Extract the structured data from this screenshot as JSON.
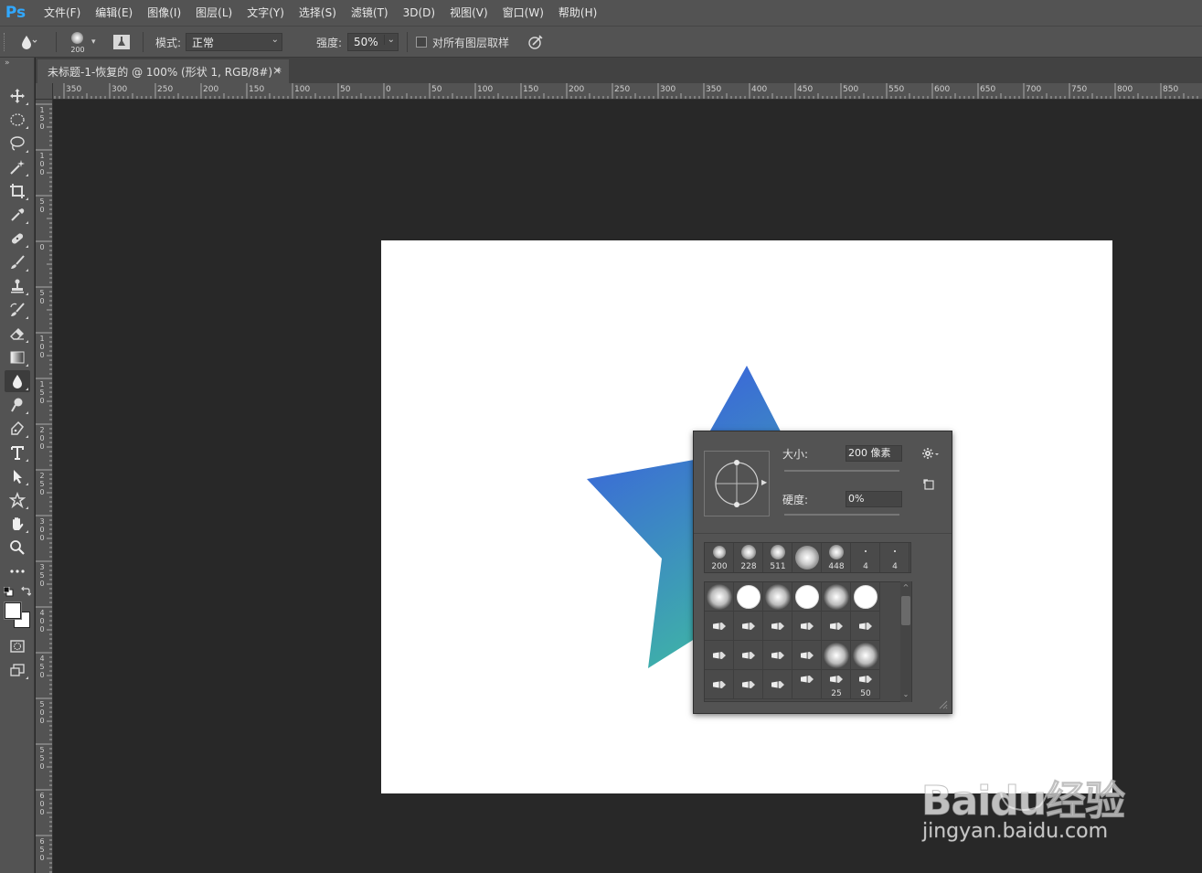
{
  "app": {
    "logo": "Ps"
  },
  "menu": [
    "文件(F)",
    "编辑(E)",
    "图像(I)",
    "图层(L)",
    "文字(Y)",
    "选择(S)",
    "滤镜(T)",
    "3D(D)",
    "视图(V)",
    "窗口(W)",
    "帮助(H)"
  ],
  "options": {
    "brush_size": "200",
    "mode_label": "模式:",
    "mode_value": "正常",
    "strength_label": "强度:",
    "strength_value": "50%",
    "sample_all_label": "对所有图层取样"
  },
  "document": {
    "tab_title": "未标题-1-恢复的 @ 100% (形状 1, RGB/8#) *",
    "close_glyph": "×"
  },
  "ruler_top": [
    "350",
    "300",
    "250",
    "200",
    "150",
    "100",
    "50",
    "0",
    "50",
    "100",
    "150",
    "200",
    "250",
    "300",
    "350",
    "400",
    "450",
    "500",
    "550",
    "600",
    "650",
    "700",
    "750",
    "800",
    "850"
  ],
  "ruler_left": [
    "150",
    "100",
    "50",
    "0",
    "50",
    "100",
    "150",
    "200",
    "250",
    "300",
    "350",
    "400",
    "450",
    "500",
    "550",
    "600",
    "650"
  ],
  "star": {
    "gradient_start": "#3a5de0",
    "gradient_end": "#3fbf9f"
  },
  "brush_picker": {
    "size_label": "大小:",
    "size_value": "200 像素",
    "hardness_label": "硬度:",
    "hardness_value": "0%",
    "size_slider_fraction": 0.74,
    "hardness_slider_fraction": 0.0,
    "recent": [
      "200",
      "228",
      "511",
      "",
      "448",
      "4",
      "4"
    ],
    "grid_labels": {
      "row4_col4": "25",
      "row4_col5": "50"
    }
  },
  "watermark": {
    "brand": "Baidu经验",
    "url": "jingyan.baidu.com"
  }
}
